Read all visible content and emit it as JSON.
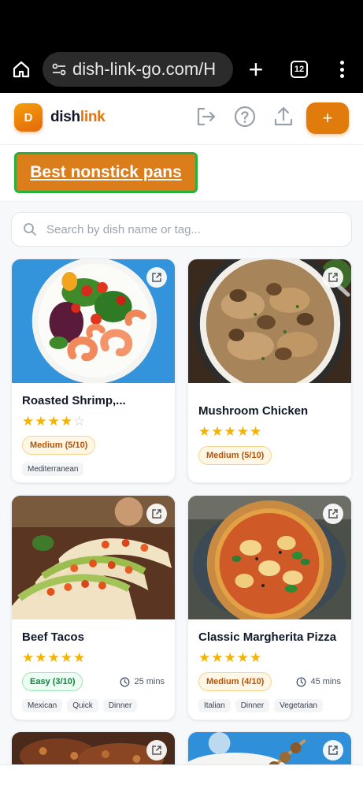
{
  "browser": {
    "url": "dish-link-go.com/H",
    "tab_count": "12"
  },
  "app": {
    "logo_letter": "D",
    "name_part1": "dish",
    "name_part2": "link",
    "add_label": "+",
    "brand_color": "#e07b0c"
  },
  "banner": {
    "label": "Best nonstick pans"
  },
  "search": {
    "placeholder": "Search by dish name or tag..."
  },
  "recipes": [
    {
      "title": "Roasted Shrimp,...",
      "rating": 4,
      "difficulty": "Medium (5/10)",
      "time": "",
      "tags": [
        "Mediterranean"
      ]
    },
    {
      "title": "Mushroom Chicken",
      "rating": 5,
      "difficulty": "Medium (5/10)",
      "time": "",
      "tags": []
    },
    {
      "title": "Beef Tacos",
      "rating": 5,
      "difficulty": "Easy (3/10)",
      "time": "25 mins",
      "tags": [
        "Mexican",
        "Quick",
        "Dinner"
      ]
    },
    {
      "title": "Classic Margherita Pizza",
      "rating": 5,
      "difficulty": "Medium (4/10)",
      "time": "45 mins",
      "tags": [
        "Italian",
        "Dinner",
        "Vegetarian"
      ]
    }
  ]
}
